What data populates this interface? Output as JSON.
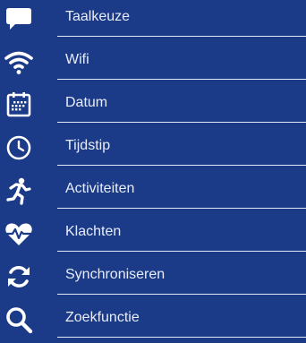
{
  "colors": {
    "background": "#1b3a87",
    "icon": "#ffffff",
    "label": "#e8edf8",
    "divider": "#e4e9f5"
  },
  "menu": {
    "items": [
      {
        "label": "Taalkeuze",
        "icon": "speech-bubble-icon"
      },
      {
        "label": "Wifi",
        "icon": "wifi-icon"
      },
      {
        "label": "Datum",
        "icon": "calendar-icon"
      },
      {
        "label": "Tijdstip",
        "icon": "clock-icon"
      },
      {
        "label": "Activiteiten",
        "icon": "running-person-icon"
      },
      {
        "label": "Klachten",
        "icon": "heart-pulse-icon"
      },
      {
        "label": "Synchroniseren",
        "icon": "sync-icon"
      },
      {
        "label": "Zoekfunctie",
        "icon": "search-icon"
      }
    ]
  }
}
